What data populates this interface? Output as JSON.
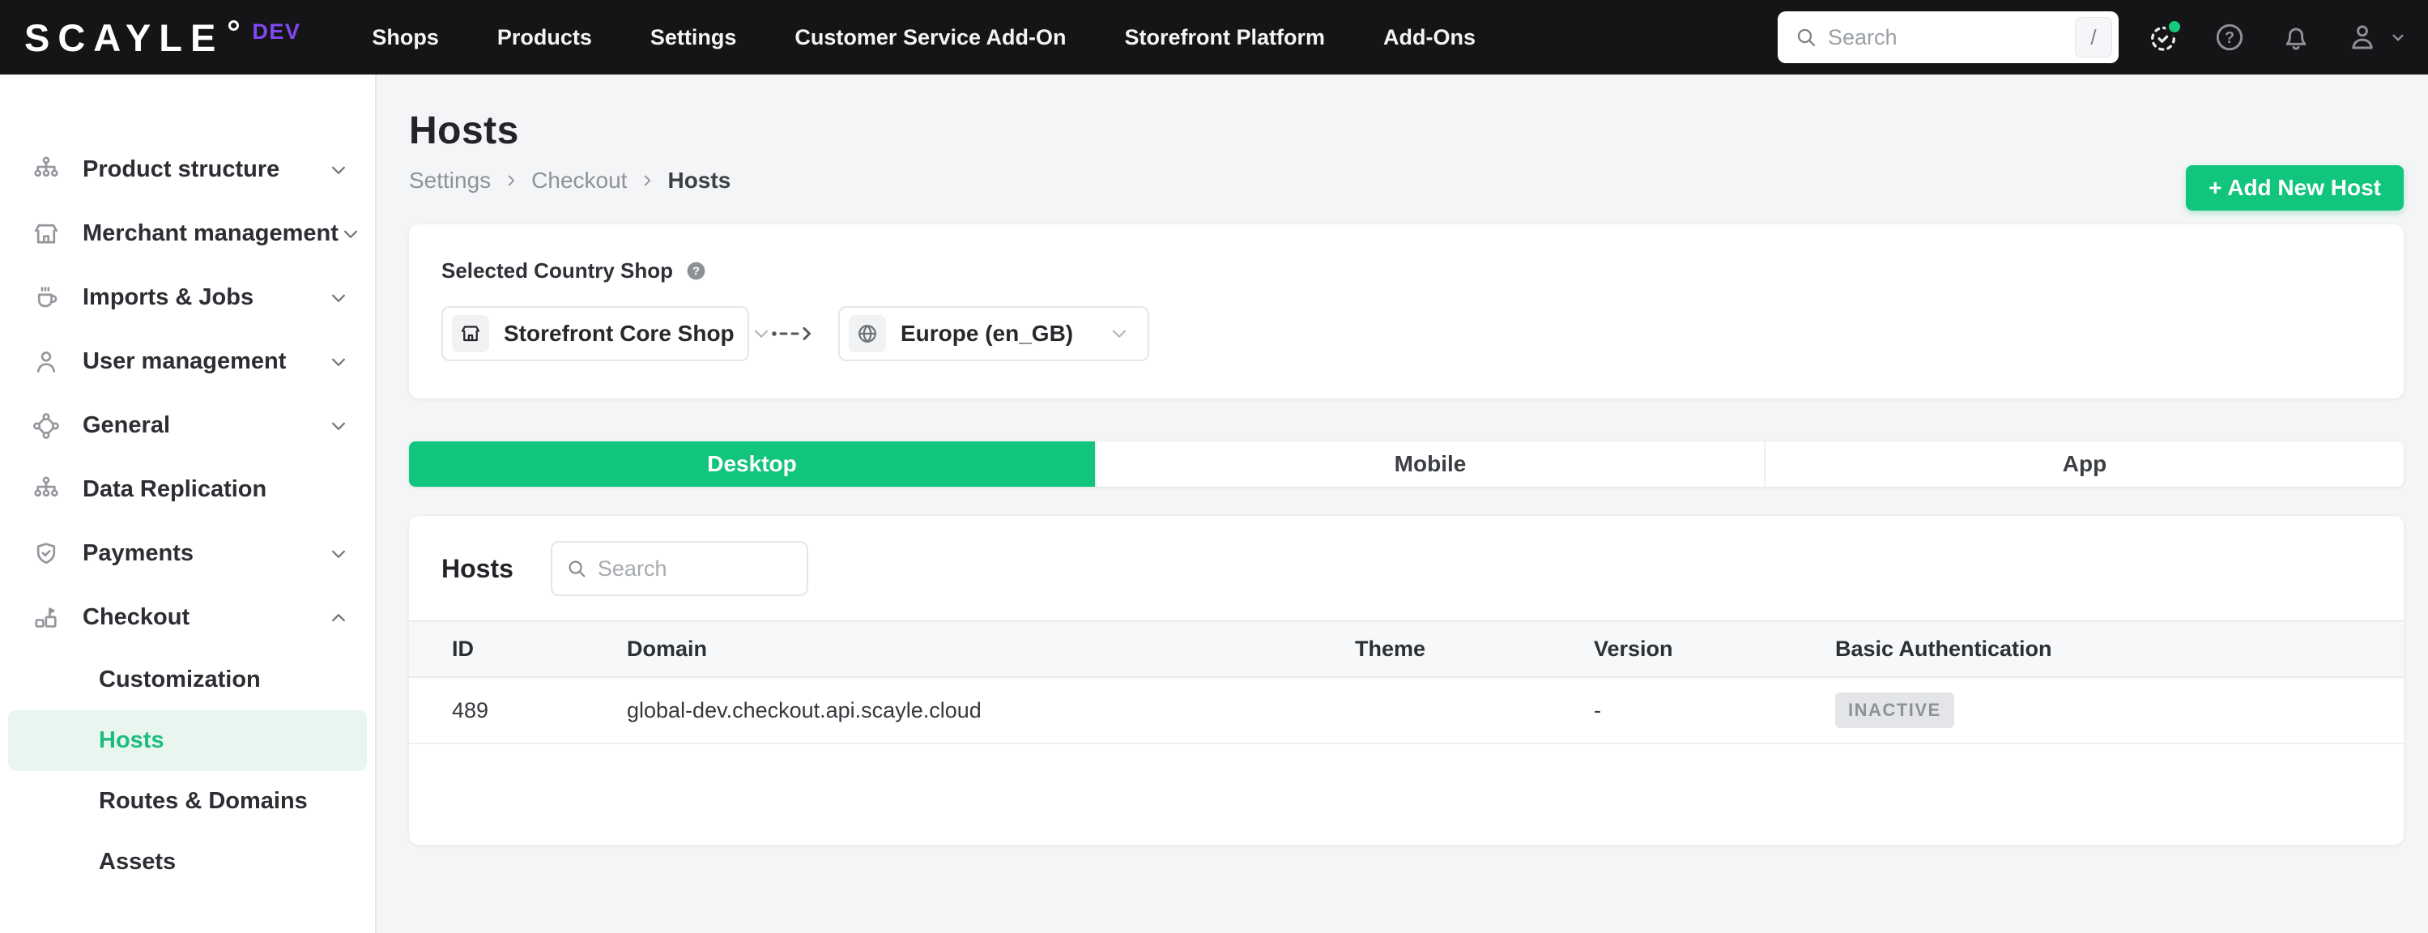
{
  "navbar": {
    "brand": "SCAYLE",
    "env_badge": "DEV",
    "items": [
      "Shops",
      "Products",
      "Settings",
      "Customer Service Add-On",
      "Storefront Platform",
      "Add-Ons"
    ],
    "search_placeholder": "Search",
    "search_shortcut": "/"
  },
  "sidebar": {
    "items": [
      {
        "label": "Product structure",
        "icon": "hierarchy-icon"
      },
      {
        "label": "Merchant management",
        "icon": "storefront-icon"
      },
      {
        "label": "Imports & Jobs",
        "icon": "coffee-icon"
      },
      {
        "label": "User management",
        "icon": "user-icon"
      },
      {
        "label": "General",
        "icon": "nodes-icon"
      },
      {
        "label": "Data Replication",
        "icon": "hierarchy-icon"
      },
      {
        "label": "Payments",
        "icon": "payments-icon"
      },
      {
        "label": "Checkout",
        "icon": "checkout-icon"
      }
    ],
    "checkout_children": [
      {
        "label": "Customization",
        "active": false
      },
      {
        "label": "Hosts",
        "active": true
      },
      {
        "label": "Routes & Domains",
        "active": false
      },
      {
        "label": "Assets",
        "active": false
      }
    ]
  },
  "page": {
    "title": "Hosts",
    "breadcrumb": [
      "Settings",
      "Checkout",
      "Hosts"
    ],
    "add_button": "+ Add New Host"
  },
  "shop_selector": {
    "label": "Selected Country Shop",
    "shop": "Storefront Core Shop",
    "country": "Europe (en_GB)"
  },
  "tabs": [
    {
      "label": "Desktop",
      "active": true
    },
    {
      "label": "Mobile",
      "active": false
    },
    {
      "label": "App",
      "active": false
    }
  ],
  "hosts_panel": {
    "title": "Hosts",
    "search_placeholder": "Search",
    "columns": [
      "ID",
      "Domain",
      "Theme",
      "Version",
      "Basic Authentication"
    ],
    "rows": [
      {
        "id": "489",
        "domain": "global-dev.checkout.api.scayle.cloud",
        "theme": "",
        "version": "-",
        "basic_auth": "INACTIVE"
      }
    ]
  },
  "colors": {
    "accent": "#12c57d",
    "accent_soft": "#e9f6ef",
    "env_badge": "#8247f5",
    "navbar_bg": "#151517",
    "badge_bg": "#e4e5e8",
    "badge_text": "#8e9196",
    "status_dot": "#16c97d"
  }
}
